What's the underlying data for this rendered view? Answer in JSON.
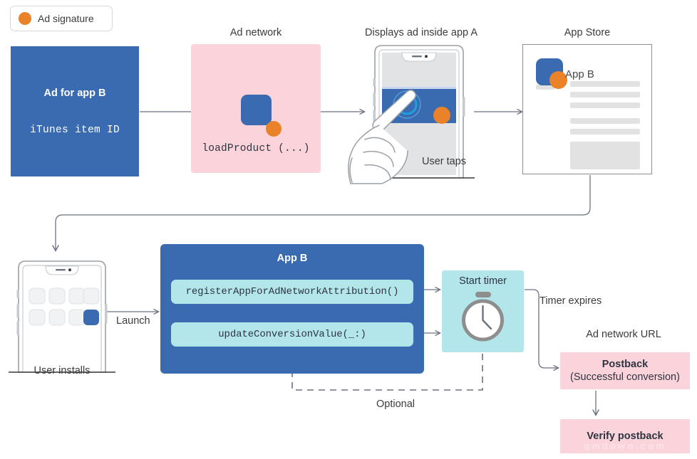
{
  "legend": {
    "icon": "orange-circle-icon",
    "label": "Ad signature",
    "color": "#e98229"
  },
  "colors": {
    "blue": "#3a6bb0",
    "pink": "#fad3db",
    "teal": "#b3e6ea",
    "orange": "#e98229",
    "line": "#6b7280",
    "skeleton": "#e2e2e2"
  },
  "captions": {
    "ad_network": "Ad network",
    "displays_ad": "Displays ad inside app A",
    "app_store": "App Store",
    "user_taps": "User taps",
    "user_installs": "User installs",
    "launch": "Launch",
    "timer_expires": "Timer expires",
    "ad_network_url": "Ad network URL",
    "optional": "Optional"
  },
  "ad_box": {
    "title": "Ad for app B",
    "subtitle": "iTunes item ID"
  },
  "ad_network_box": {
    "code": "loadProduct (...)"
  },
  "app_store_card": {
    "app_name": "App B"
  },
  "app_b_box": {
    "title": "App B",
    "apis": [
      "registerAppForAdNetworkAttribution()",
      "updateConversionValue(_:)"
    ]
  },
  "timer_box": {
    "title": "Start timer",
    "icon": "stopwatch-icon"
  },
  "postback_box": {
    "title": "Postback",
    "subtitle": "(Successful conversion)"
  },
  "verify_box": {
    "title": "Verify postback"
  },
  "watermark": {
    "text": "qmdown.com"
  }
}
